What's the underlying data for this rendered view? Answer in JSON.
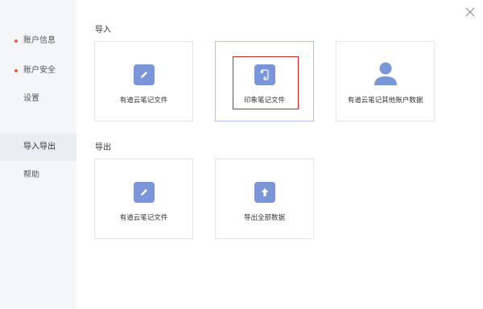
{
  "sidebar": {
    "items": [
      {
        "label": "账户信息",
        "dot": true
      },
      {
        "label": "账户安全",
        "dot": true
      },
      {
        "label": "设置",
        "dot": false
      },
      {
        "label": "导入导出",
        "dot": false,
        "active": true
      },
      {
        "label": "帮助",
        "dot": false
      }
    ]
  },
  "import_section": {
    "title": "导入",
    "cards": [
      {
        "label": "有道云笔记文件",
        "icon": "pencil-icon"
      },
      {
        "label": "印象笔记文件",
        "icon": "evernote-icon",
        "selected": true
      },
      {
        "label": "有道云笔记其他账户数据",
        "icon": "person-icon"
      }
    ]
  },
  "export_section": {
    "title": "导出",
    "cards": [
      {
        "label": "有道云笔记文件",
        "icon": "pencil-icon"
      },
      {
        "label": "导出全部数据",
        "icon": "upload-arrow-icon"
      }
    ]
  },
  "colors": {
    "accent": "#7b96d8",
    "dot": "#e8603c",
    "highlight": "#d42020"
  }
}
